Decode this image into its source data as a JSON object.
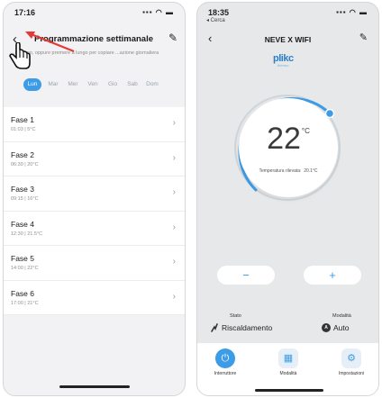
{
  "colors": {
    "accent": "#3d9ce6",
    "arrow": "#e53935",
    "bg_screen1": "#f2f2f4",
    "bg_screen2": "#e6e8ea"
  },
  "screen1": {
    "status": {
      "time": "17:16"
    },
    "title": "Programmazione settimanale",
    "hint": "...il giorno, oppure premere a lungo per copiare ...azione giornaliera",
    "days": [
      "Lun",
      "Mar",
      "Mer",
      "Ven",
      "Gio",
      "Sab",
      "Dom"
    ],
    "selected_day": "Lun",
    "phases": [
      {
        "name": "Fase 1",
        "detail": "01:03 | 5°C"
      },
      {
        "name": "Fase 2",
        "detail": "06:30 | 20°C"
      },
      {
        "name": "Fase 3",
        "detail": "09:15 | 16°C"
      },
      {
        "name": "Fase 4",
        "detail": "12:30 | 21.5°C"
      },
      {
        "name": "Fase 5",
        "detail": "14:00 | 22°C"
      },
      {
        "name": "Fase 6",
        "detail": "17:00 | 21°C"
      }
    ],
    "icons": {
      "back": "chevron-left-icon",
      "edit": "pencil-icon",
      "hand": "pointing-hand-icon",
      "arrow": "red-arrow-icon"
    }
  },
  "screen2": {
    "status": {
      "time": "18:35",
      "back_link": "◂ Cerca"
    },
    "title": "NEVE X WIFI",
    "logo": {
      "text": "plikc",
      "sub": "thermo"
    },
    "temperature": "22",
    "temperature_unit": "°C",
    "measured_label": "Temperatura rilevata:",
    "measured_value": "20.1°C",
    "minus": "−",
    "plus": "+",
    "stato_label": "Stato",
    "stato_value": "Riscaldamento",
    "modalita_label": "Modalità",
    "modalita_value": "Auto",
    "nav": [
      {
        "label": "Interruttore",
        "icon": "power-icon"
      },
      {
        "label": "Modalità",
        "icon": "grid-icon"
      },
      {
        "label": "Impostazioni",
        "icon": "settings-icon"
      }
    ]
  }
}
